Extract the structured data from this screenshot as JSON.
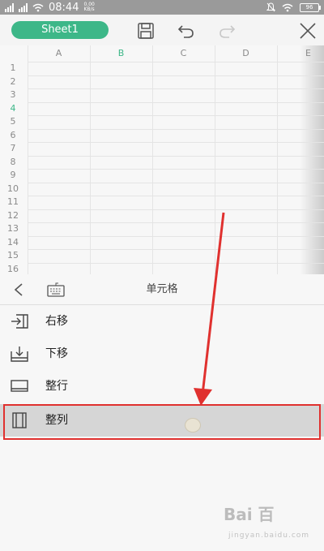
{
  "status_bar": {
    "time": "08:44",
    "speed": "0.00 KB/s",
    "battery": "96"
  },
  "toolbar": {
    "sheet_tab": "Sheet1",
    "icons": [
      "save-icon",
      "undo-icon",
      "redo-icon",
      "close-icon"
    ]
  },
  "grid": {
    "columns": [
      "A",
      "B",
      "C",
      "D",
      "E"
    ],
    "rows": [
      "1",
      "2",
      "3",
      "4",
      "5",
      "6",
      "7",
      "8",
      "9",
      "10",
      "11",
      "12",
      "13",
      "14",
      "15",
      "16"
    ],
    "active_column": "B",
    "active_row": "4",
    "accent_color": "#3db788"
  },
  "panel": {
    "title": "单元格",
    "items": [
      {
        "label": "右移",
        "icon": "shift-right-icon"
      },
      {
        "label": "下移",
        "icon": "shift-down-icon"
      },
      {
        "label": "整行",
        "icon": "entire-row-icon"
      },
      {
        "label": "整列",
        "icon": "entire-column-icon"
      }
    ],
    "selected_index": 3
  },
  "annotation": {
    "arrow_color": "#e0312f",
    "highlight_color": "#e0312f"
  },
  "watermark": {
    "logo": "Bai 百",
    "sub": "jingyan.baidu.com"
  }
}
